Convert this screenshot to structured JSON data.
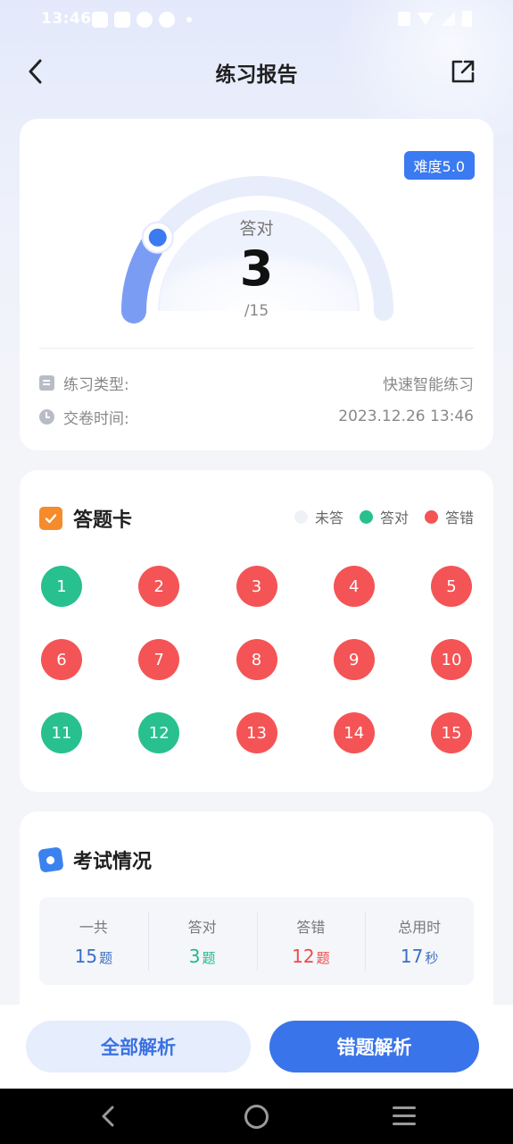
{
  "status_bar": {
    "time": "13:46"
  },
  "header": {
    "title": "练习报告",
    "back_icon": "chevron-left-icon",
    "share_icon": "external-share-icon"
  },
  "score_card": {
    "difficulty": "难度5.0",
    "score_label": "答对",
    "score_value": "3",
    "score_total": "/15",
    "gauge_fraction": 0.2,
    "practice_type_label": "练习类型:",
    "practice_type_value": "快速智能练习",
    "submit_time_label": "交卷时间:",
    "submit_time_value": "2023.12.26 13:46"
  },
  "answer_card": {
    "title": "答题卡",
    "legend": {
      "unanswered": "未答",
      "correct": "答对",
      "wrong": "答错"
    },
    "questions": [
      {
        "n": "1",
        "status": "correct"
      },
      {
        "n": "2",
        "status": "wrong"
      },
      {
        "n": "3",
        "status": "wrong"
      },
      {
        "n": "4",
        "status": "wrong"
      },
      {
        "n": "5",
        "status": "wrong"
      },
      {
        "n": "6",
        "status": "wrong"
      },
      {
        "n": "7",
        "status": "wrong"
      },
      {
        "n": "8",
        "status": "wrong"
      },
      {
        "n": "9",
        "status": "wrong"
      },
      {
        "n": "10",
        "status": "wrong"
      },
      {
        "n": "11",
        "status": "correct"
      },
      {
        "n": "12",
        "status": "correct"
      },
      {
        "n": "13",
        "status": "wrong"
      },
      {
        "n": "14",
        "status": "wrong"
      },
      {
        "n": "15",
        "status": "wrong"
      }
    ]
  },
  "exam_card": {
    "title": "考试情况",
    "stats": [
      {
        "label": "一共",
        "value": "15",
        "unit": "题"
      },
      {
        "label": "答对",
        "value": "3",
        "unit": "题"
      },
      {
        "label": "答错",
        "value": "12",
        "unit": "题"
      },
      {
        "label": "总用时",
        "value": "17",
        "unit": "秒"
      }
    ]
  },
  "actions": {
    "all_analysis": "全部解析",
    "wrong_analysis": "错题解析"
  },
  "colors": {
    "accent": "#3a74ea",
    "correct": "#28c08e",
    "wrong": "#f45455",
    "unanswered": "#eef1f6"
  }
}
